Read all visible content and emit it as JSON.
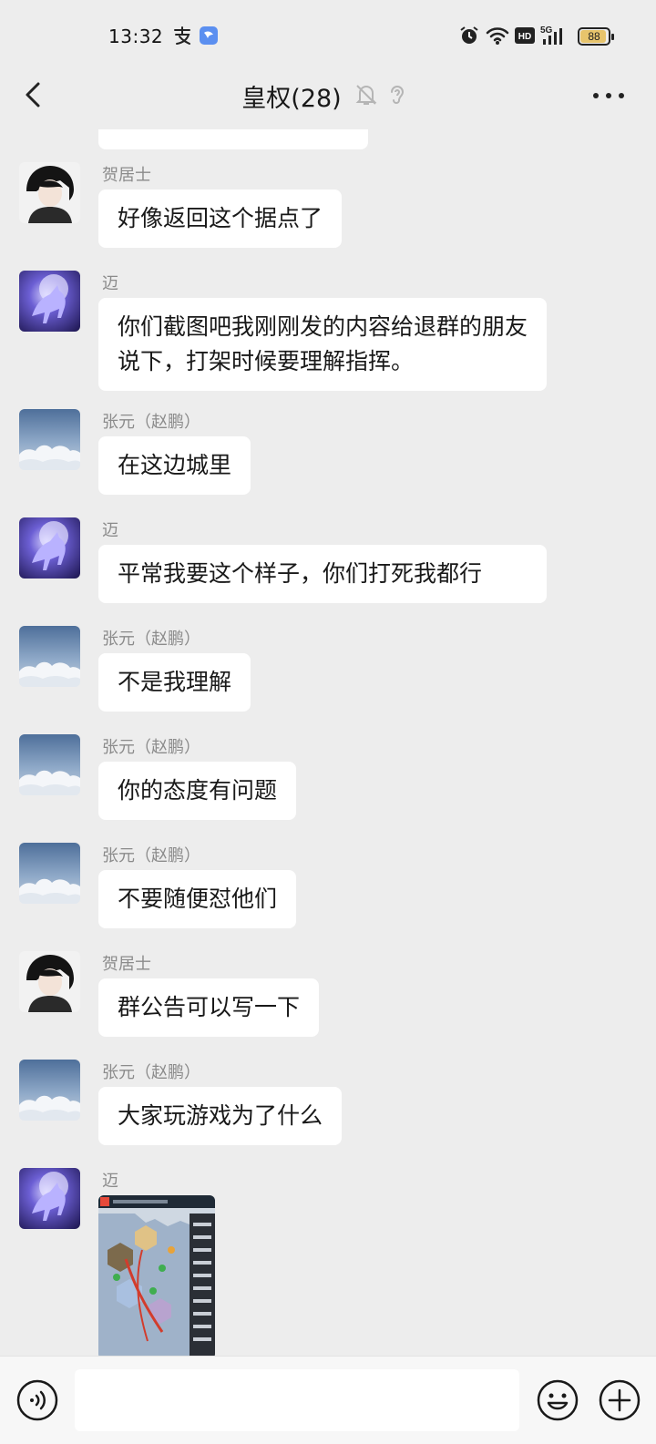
{
  "status": {
    "time": "13:32",
    "battery": "88",
    "icons": [
      "alipay-icon",
      "app-badge-icon",
      "alarm-icon",
      "wifi-icon",
      "hd-icon",
      "5g-signal-icon",
      "battery-icon"
    ],
    "network": "5G",
    "hd": "HD"
  },
  "nav": {
    "title": "皇权(28)",
    "icons": [
      "back-icon",
      "muted-bell-icon",
      "ear-icon",
      "more-icon"
    ]
  },
  "messages": [
    {
      "sender": "贺居士",
      "text": "好像返回这个据点了",
      "avatar": "boy"
    },
    {
      "sender": "迈",
      "text": "你们截图吧我刚刚发的内容给退群的朋友说下，打架时候要理解指挥。",
      "avatar": "unicorn"
    },
    {
      "sender": "张元（赵鹏）",
      "text": "在这边城里",
      "avatar": "sky"
    },
    {
      "sender": "迈",
      "text": "平常我要这个样子，你们打死我都行",
      "avatar": "unicorn"
    },
    {
      "sender": "张元（赵鹏）",
      "text": "不是我理解",
      "avatar": "sky"
    },
    {
      "sender": "张元（赵鹏）",
      "text": "你的态度有问题",
      "avatar": "sky"
    },
    {
      "sender": "张元（赵鹏）",
      "text": "不要随便怼他们",
      "avatar": "sky"
    },
    {
      "sender": "贺居士",
      "text": "群公告可以写一下",
      "avatar": "boy"
    },
    {
      "sender": "张元（赵鹏）",
      "text": "大家玩游戏为了什么",
      "avatar": "sky"
    },
    {
      "sender": "迈",
      "text": "",
      "avatar": "unicorn",
      "image": "game-map-screenshot"
    }
  ],
  "input": {
    "icons": [
      "voice-icon",
      "emoji-icon",
      "plus-icon"
    ]
  }
}
